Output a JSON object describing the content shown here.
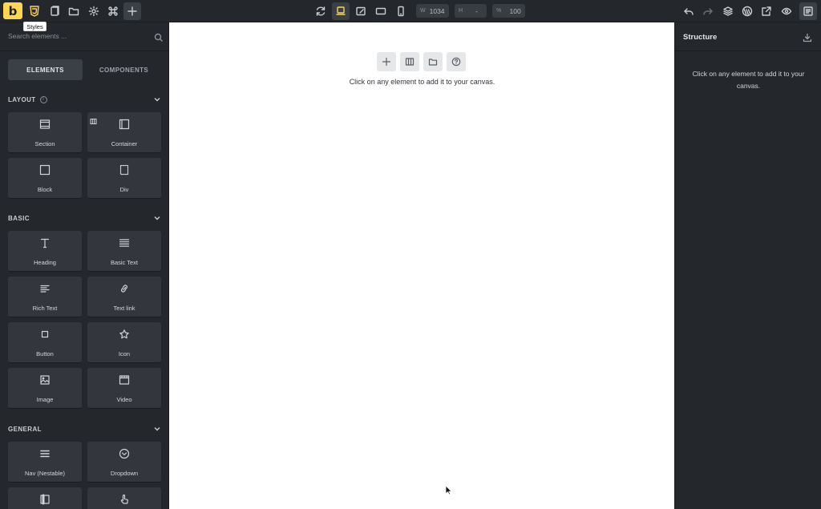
{
  "app": {
    "logo_letter": "b",
    "tooltip": "Styles"
  },
  "toolbar": {
    "left_icons": [
      "css3-icon",
      "pages-icon",
      "folder-icon",
      "gear-icon",
      "command-icon",
      "plus-icon"
    ],
    "center_icons": [
      "refresh-icon",
      "desktop-breakpoint-icon",
      "edit-breakpoint-icon",
      "tablet-landscape-icon",
      "mobile-icon"
    ],
    "width": {
      "label": "W",
      "value": "1034"
    },
    "height": {
      "label": "H",
      "value": "-"
    },
    "zoom": {
      "label": "%",
      "value": "100"
    },
    "right_icons": [
      "undo-icon",
      "redo-icon",
      "layers-icon",
      "wordpress-icon",
      "external-link-icon",
      "eye-icon",
      "panel-toggle-icon"
    ],
    "accent": "#ffd64f"
  },
  "left_panel": {
    "search_placeholder": "Search elements ...",
    "tabs": [
      {
        "label": "ELEMENTS",
        "active": true
      },
      {
        "label": "COMPONENTS",
        "active": false
      }
    ],
    "sections": [
      {
        "title": "LAYOUT",
        "items": [
          "Section",
          "Container",
          "Block",
          "Div"
        ]
      },
      {
        "title": "BASIC",
        "items": [
          "Heading",
          "Basic Text",
          "Rich Text",
          "Text link",
          "Button",
          "Icon",
          "Image",
          "Video"
        ]
      },
      {
        "title": "GENERAL",
        "items": [
          "Nav (Nestable)",
          "Dropdown",
          "",
          ""
        ]
      }
    ]
  },
  "canvas": {
    "message": "Click on any element to add it to your canvas.",
    "buttons": [
      "plus-icon",
      "columns-icon",
      "folder-icon",
      "help-icon"
    ]
  },
  "right_panel": {
    "title": "Structure",
    "message": "Click on any element to add it to your canvas."
  }
}
